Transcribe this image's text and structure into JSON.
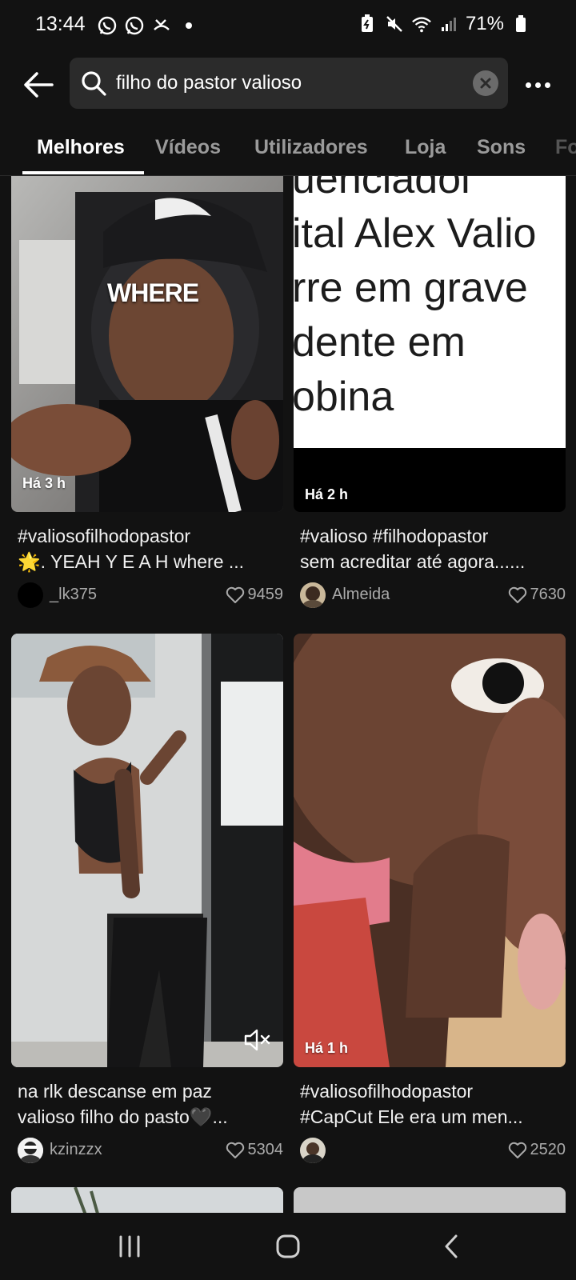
{
  "status": {
    "time": "13:44",
    "battery": "71%"
  },
  "search": {
    "query": "filho do pastor valioso"
  },
  "tabs": [
    {
      "label": "Melhores",
      "active": true
    },
    {
      "label": "Vídeos",
      "active": false
    },
    {
      "label": "Utilizadores",
      "active": false
    },
    {
      "label": "Loja",
      "active": false
    },
    {
      "label": "Sons",
      "active": false
    },
    {
      "label": "Fo",
      "active": false
    }
  ],
  "videos": [
    {
      "time_ago": "Há 3 h",
      "overlay_text": "WHERE",
      "caption_line1": "#valiosofilhodopastor",
      "caption_line2": "🌟. YEAH Y E A H where ...",
      "username": "_lk375",
      "likes": "9459"
    },
    {
      "time_ago": "Há 2 h",
      "overlay_lines": [
        "uenciadoi",
        "ital Alex Valio",
        "rre em grave",
        "dente em",
        "obina"
      ],
      "caption_line1": "#valioso #filhodopastor",
      "caption_line2": "sem acreditar até agora......",
      "username": "Almeida",
      "likes": "7630"
    },
    {
      "time_ago": "",
      "caption_line1": "na rlk descanse em paz",
      "caption_line2": "valioso filho do pasto🖤...",
      "username": "kzinzzx",
      "likes": "5304"
    },
    {
      "time_ago": "Há 1 h",
      "caption_line1": "#valiosofilhodopastor",
      "caption_line2": "#CapCut Ele era um men...",
      "username": "",
      "likes": "2520"
    }
  ]
}
